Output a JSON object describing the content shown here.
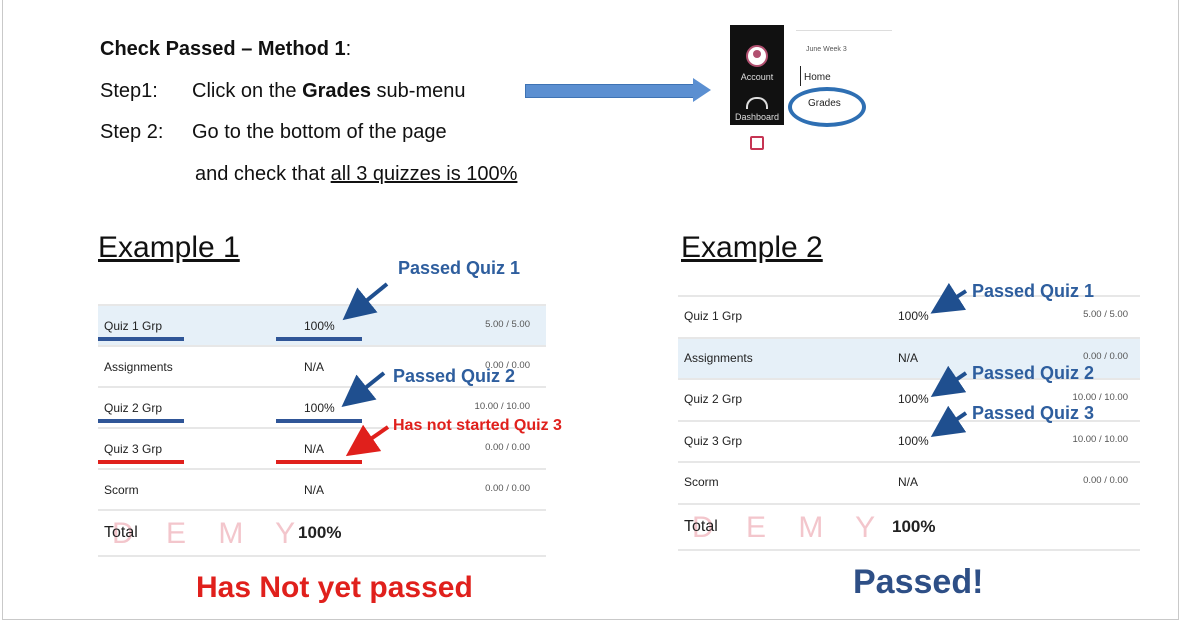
{
  "instructions": {
    "heading": "Check Passed – Method 1",
    "heading_colon": ":",
    "step1_label": "Step1:",
    "step1_pre": "Click on the ",
    "step1_bold": "Grades",
    "step1_post": " sub-menu",
    "step2_label": "Step 2:",
    "step2_text": "Go to the bottom of the page",
    "step2_cont_pre": "and check that ",
    "step2_cont_underline": "all 3 quizzes is 100%"
  },
  "mini_screenshot": {
    "account_label": "Account",
    "dashboard_label": "Dashboard",
    "breadcrumb": "June Week 3",
    "menu_home": "Home",
    "menu_grades": "Grades"
  },
  "example1": {
    "title": "Example 1",
    "rows": [
      {
        "name": "Quiz 1 Grp",
        "score": "100%",
        "points": "5.00 / 5.00"
      },
      {
        "name": "Assignments",
        "score": "N/A",
        "points": "0.00 / 0.00"
      },
      {
        "name": "Quiz 2 Grp",
        "score": "100%",
        "points": "10.00 / 10.00"
      },
      {
        "name": "Quiz 3 Grp",
        "score": "N/A",
        "points": "0.00 / 0.00"
      },
      {
        "name": "Scorm",
        "score": "N/A",
        "points": "0.00 / 0.00"
      }
    ],
    "total_label": "Total",
    "total_value": "100%",
    "watermark": "D E M Y",
    "callout_quiz1": "Passed Quiz 1",
    "callout_quiz2": "Passed Quiz 2",
    "callout_quiz3": "Has not started Quiz 3",
    "result": "Has Not yet passed"
  },
  "example2": {
    "title": "Example 2",
    "rows": [
      {
        "name": "Quiz 1 Grp",
        "score": "100%",
        "points": "5.00 / 5.00"
      },
      {
        "name": "Assignments",
        "score": "N/A",
        "points": "0.00 / 0.00"
      },
      {
        "name": "Quiz 2 Grp",
        "score": "100%",
        "points": "10.00 / 10.00"
      },
      {
        "name": "Quiz 3 Grp",
        "score": "100%",
        "points": "10.00 / 10.00"
      },
      {
        "name": "Scorm",
        "score": "N/A",
        "points": "0.00 / 0.00"
      }
    ],
    "total_label": "Total",
    "total_value": "100%",
    "watermark": "D E M Y",
    "callout_quiz1": "Passed Quiz 1",
    "callout_quiz2": "Passed Quiz 2",
    "callout_quiz3": "Passed Quiz 3",
    "result": "Passed!"
  },
  "colors": {
    "accent_blue": "#2e5e9e",
    "alert_red": "#e0201c",
    "row_highlight": "#e6f0f8"
  }
}
